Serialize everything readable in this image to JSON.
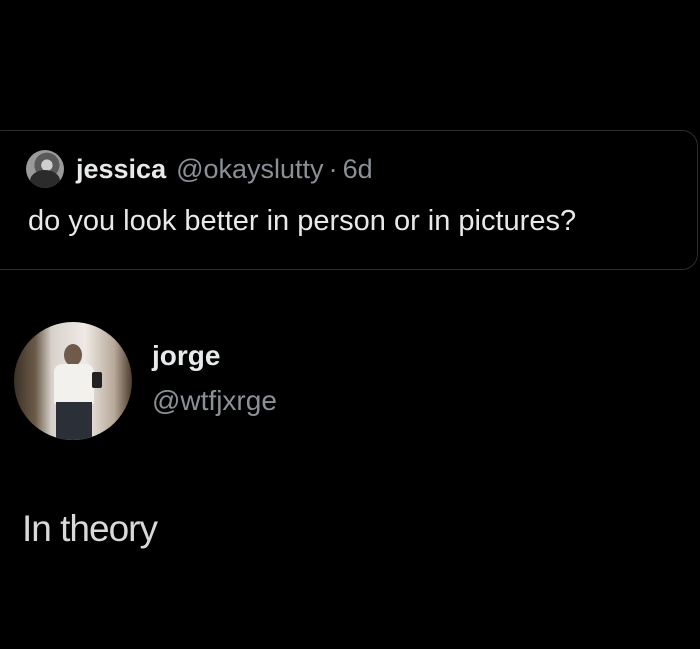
{
  "quoted_tweet": {
    "name": "jessica",
    "handle": "@okayslutty",
    "separator": "·",
    "time": "6d",
    "text": "do you look better in person or in pictures?"
  },
  "tweet": {
    "name": "jorge",
    "handle": "@wtfjxrge",
    "text": "In theory"
  },
  "colors": {
    "background": "#000000",
    "primary_text": "#e7e9ea",
    "secondary_text": "#8b9096",
    "card_border": "#2a2d31"
  }
}
